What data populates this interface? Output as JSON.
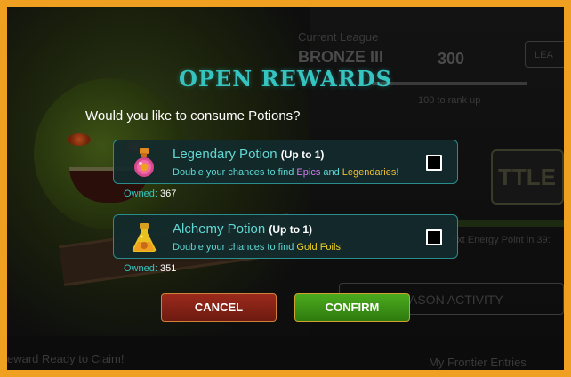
{
  "background": {
    "league_caption": "Current League",
    "league_name": "BRONZE III",
    "league_score": "300",
    "league_button": "LEA",
    "rank_text": "100 to rank up",
    "battle_label": "TTLE",
    "energy_text": "ext Energy Point in  39:",
    "season_button": "ASON ACTIVITY",
    "reward_text": "eward Ready to Claim!",
    "frontier_text": "My Frontier Entries"
  },
  "modal": {
    "title": "OPEN REWARDS",
    "question": "Would you like to consume Potions?",
    "potions": [
      {
        "name": "Legendary Potion",
        "cap": "(Up to 1)",
        "desc_prefix": "Double your chances to find ",
        "desc_hl1": "Epics",
        "desc_mid": " and ",
        "desc_hl2": "Legendaries!",
        "owned_label": "Owned:",
        "owned_value": "367",
        "checked": false,
        "icon": "legendary-potion-icon"
      },
      {
        "name": "Alchemy Potion",
        "cap": "(Up to 1)",
        "desc_prefix": "Double your chances to find ",
        "desc_hl1": "Gold Foils!",
        "owned_label": "Owned:",
        "owned_value": "351",
        "checked": false,
        "icon": "alchemy-potion-icon"
      }
    ],
    "cancel_label": "CANCEL",
    "confirm_label": "CONFIRM"
  },
  "colors": {
    "frame": "#f0a020",
    "title": "#35c4c0",
    "epic": "#d57bf0",
    "legendary": "#f0c030",
    "cancel": "#9a2a1c",
    "confirm": "#4caa1e"
  }
}
